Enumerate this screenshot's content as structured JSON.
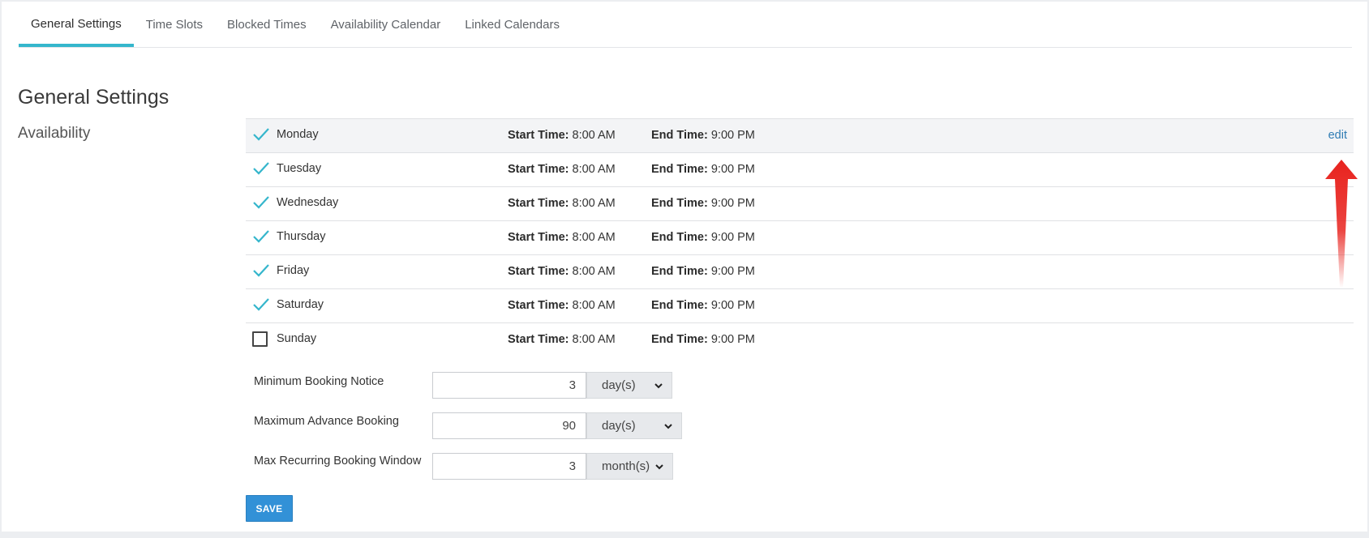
{
  "tabs": [
    {
      "label": "General Settings",
      "active": true
    },
    {
      "label": "Time Slots"
    },
    {
      "label": "Blocked Times"
    },
    {
      "label": "Availability Calendar"
    },
    {
      "label": "Linked Calendars"
    }
  ],
  "page_title": "General Settings",
  "section_label": "Availability",
  "availability": {
    "start_label": "Start Time:",
    "end_label": "End Time:",
    "edit_label": "edit",
    "days": [
      {
        "day": "Monday",
        "checked": true,
        "start": "8:00 AM",
        "end": "9:00 PM"
      },
      {
        "day": "Tuesday",
        "checked": true,
        "start": "8:00 AM",
        "end": "9:00 PM"
      },
      {
        "day": "Wednesday",
        "checked": true,
        "start": "8:00 AM",
        "end": "9:00 PM"
      },
      {
        "day": "Thursday",
        "checked": true,
        "start": "8:00 AM",
        "end": "9:00 PM"
      },
      {
        "day": "Friday",
        "checked": true,
        "start": "8:00 AM",
        "end": "9:00 PM"
      },
      {
        "day": "Saturday",
        "checked": true,
        "start": "8:00 AM",
        "end": "9:00 PM"
      },
      {
        "day": "Sunday",
        "checked": false,
        "start": "8:00 AM",
        "end": "9:00 PM"
      }
    ]
  },
  "form": {
    "min_notice": {
      "label": "Minimum Booking Notice",
      "value": "3",
      "unit": "day(s)"
    },
    "max_advance": {
      "label": "Maximum Advance Booking",
      "value": "90",
      "unit": "day(s)"
    },
    "max_recurring": {
      "label": "Max Recurring Booking Window",
      "value": "3",
      "unit": "month(s)"
    }
  },
  "save_label": "SAVE",
  "colors": {
    "accent": "#35b6cc",
    "button": "#3291d7",
    "link": "#2f7cb4",
    "annotation_arrow": "#e8231e"
  }
}
